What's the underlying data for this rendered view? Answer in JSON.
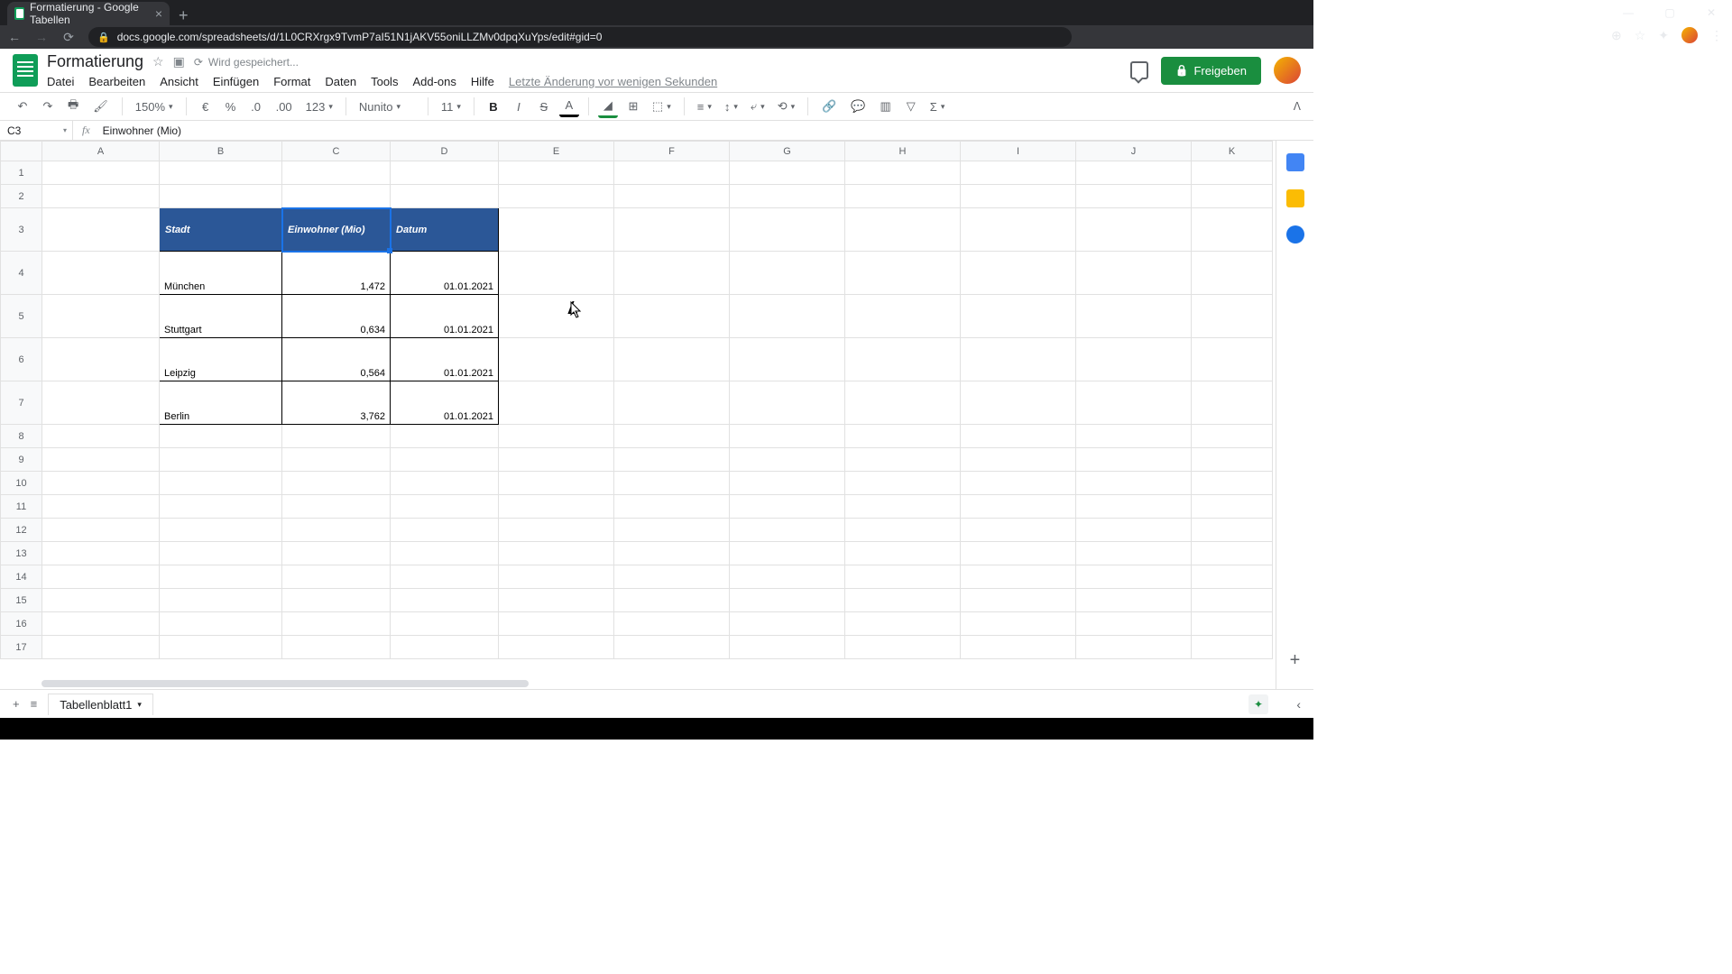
{
  "browser": {
    "tab_title": "Formatierung - Google Tabellen",
    "url": "docs.google.com/spreadsheets/d/1L0CRXrgx9TvmP7aI51N1jAKV55oniLLZMv0dpqXuYps/edit#gid=0"
  },
  "doc": {
    "title": "Formatierung",
    "saving": "Wird gespeichert...",
    "last_edit": "Letzte Änderung vor wenigen Sekunden",
    "share_label": "Freigeben"
  },
  "menu": {
    "file": "Datei",
    "edit": "Bearbeiten",
    "view": "Ansicht",
    "insert": "Einfügen",
    "format": "Format",
    "data": "Daten",
    "tools": "Tools",
    "addons": "Add-ons",
    "help": "Hilfe"
  },
  "toolbar": {
    "zoom": "150%",
    "currency": "€",
    "percent": "%",
    "dec_dec": ".0",
    "inc_dec": ".00",
    "more_fmt": "123",
    "font": "Nunito",
    "font_size": "11",
    "bold": "B",
    "italic": "I",
    "strike": "S",
    "textcolor": "A"
  },
  "fx": {
    "cell_ref": "C3",
    "label": "fx",
    "value": "Einwohner (Mio)"
  },
  "columns": [
    "A",
    "B",
    "C",
    "D",
    "E",
    "F",
    "G",
    "H",
    "I",
    "J",
    "K"
  ],
  "rows": [
    "1",
    "2",
    "3",
    "4",
    "5",
    "6",
    "7",
    "8",
    "9",
    "10",
    "11",
    "12",
    "13",
    "14",
    "15",
    "16",
    "17"
  ],
  "table": {
    "headers": {
      "b": "Stadt",
      "c": "Einwohner (Mio)",
      "d": "Datum"
    },
    "rows": [
      {
        "b": "München",
        "c": "1,472",
        "d": "01.01.2021"
      },
      {
        "b": "Stuttgart",
        "c": "0,634",
        "d": "01.01.2021"
      },
      {
        "b": "Leipzig",
        "c": "0,564",
        "d": "01.01.2021"
      },
      {
        "b": "Berlin",
        "c": "3,762",
        "d": "01.01.2021"
      }
    ]
  },
  "sheet_tab": "Tabellenblatt1"
}
